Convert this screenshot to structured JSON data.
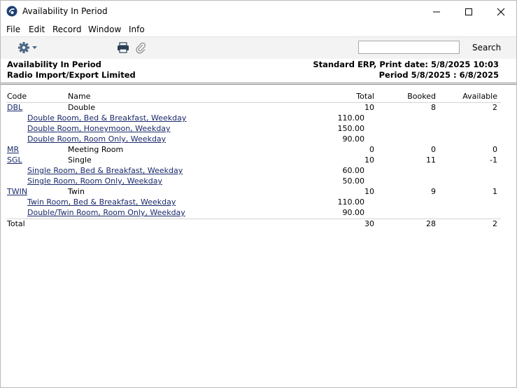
{
  "window": {
    "title": "Availability In Period"
  },
  "menu": [
    "File",
    "Edit",
    "Record",
    "Window",
    "Info"
  ],
  "toolbar": {
    "search_placeholder": "",
    "search_label": "Search"
  },
  "report_header": {
    "title": "Availability In Period",
    "company": "Radio Import/Export Limited",
    "print_info": "Standard ERP, Print date: 5/8/2025 10:03",
    "period": "Period  5/8/2025 : 6/8/2025"
  },
  "table": {
    "headers": {
      "code": "Code",
      "name": "Name",
      "total": "Total",
      "booked": "Booked",
      "available": "Available"
    },
    "rooms": [
      {
        "code": "DBL",
        "name": "Double",
        "total": "10",
        "booked": "8",
        "available": "2",
        "rates": [
          {
            "name": "Double Room, Bed & Breakfast, Weekday",
            "price": "110.00"
          },
          {
            "name": "Double Room, Honeymoon, Weekday",
            "price": "150.00"
          },
          {
            "name": "Double Room, Room Only, Weekday",
            "price": "90.00"
          }
        ]
      },
      {
        "code": "MR",
        "name": "Meeting Room",
        "total": "0",
        "booked": "0",
        "available": "0",
        "rates": []
      },
      {
        "code": "SGL",
        "name": "Single",
        "total": "10",
        "booked": "11",
        "available": "-1",
        "rates": [
          {
            "name": "Single Room, Bed & Breakfast, Weekday",
            "price": "60.00"
          },
          {
            "name": "Single Room, Room Only, Weekday",
            "price": "50.00"
          }
        ]
      },
      {
        "code": "TWIN",
        "name": "Twin",
        "total": "10",
        "booked": "9",
        "available": "1",
        "rates": [
          {
            "name": "Twin Room, Bed & Breakfast, Weekday",
            "price": "110.00"
          },
          {
            "name": "Double/Twin Room, Room Only, Weekday",
            "price": "90.00"
          }
        ]
      }
    ],
    "total_row": {
      "label": "Total",
      "total": "30",
      "booked": "28",
      "available": "2"
    }
  }
}
